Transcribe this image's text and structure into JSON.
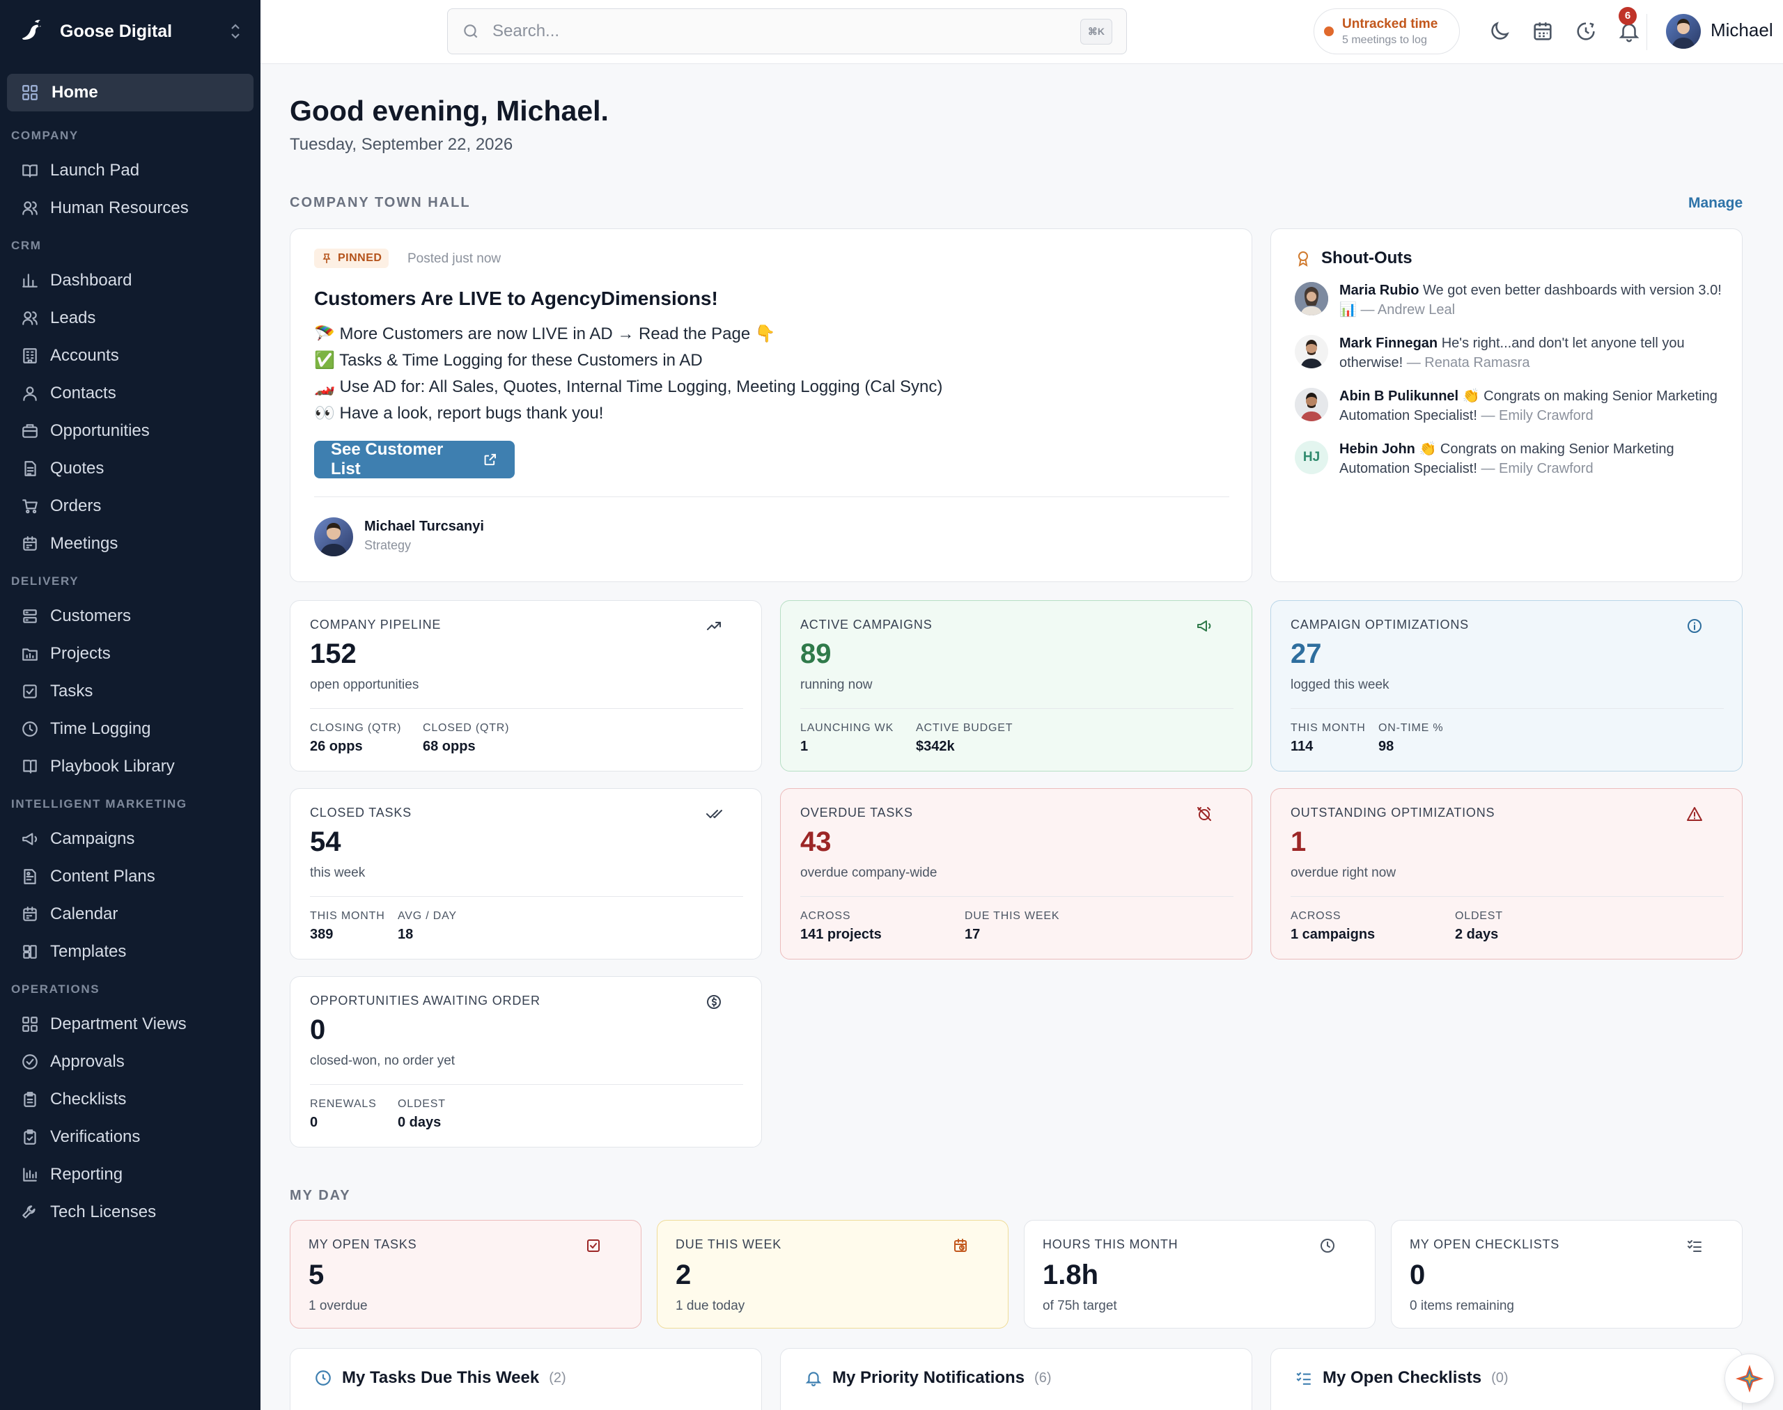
{
  "brand": {
    "name": "Goose Digital"
  },
  "sidebar": {
    "home": "Home",
    "sections": [
      {
        "title": "COMPANY",
        "items": [
          "Launch Pad",
          "Human Resources"
        ]
      },
      {
        "title": "CRM",
        "items": [
          "Dashboard",
          "Leads",
          "Accounts",
          "Contacts",
          "Opportunities",
          "Quotes",
          "Orders",
          "Meetings"
        ]
      },
      {
        "title": "DELIVERY",
        "items": [
          "Customers",
          "Projects",
          "Tasks",
          "Time Logging",
          "Playbook Library"
        ]
      },
      {
        "title": "INTELLIGENT MARKETING",
        "items": [
          "Campaigns",
          "Content Plans",
          "Calendar",
          "Templates"
        ]
      },
      {
        "title": "OPERATIONS",
        "items": [
          "Department Views",
          "Approvals",
          "Checklists",
          "Verifications",
          "Reporting",
          "Tech Licenses"
        ]
      }
    ]
  },
  "topbar": {
    "search_placeholder": "Search...",
    "search_shortcut": "⌘K",
    "untracked_title": "Untracked time",
    "untracked_sub": "5 meetings to log",
    "notification_count": "6",
    "user_name": "Michael"
  },
  "greeting": "Good evening, Michael.",
  "date": "Tuesday, September 22, 2026",
  "town_hall": {
    "section_title": "COMPANY TOWN HALL",
    "manage_label": "Manage",
    "pinned_label": "PINNED",
    "posted": "Posted just now",
    "title": "Customers Are LIVE to AgencyDimensions!",
    "lines": [
      "🪂 More Customers are now LIVE in AD → Read the Page 👇",
      "✅ Tasks & Time Logging for these Customers in AD",
      "🏎️ Use AD for: All Sales, Quotes, Internal Time Logging, Meeting Logging (Cal Sync)",
      "👀 Have a look, report bugs thank you!"
    ],
    "cta_label": "See Customer List",
    "author_name": "Michael Turcsanyi",
    "author_dept": "Strategy"
  },
  "shoutouts": {
    "title": "Shout-Outs",
    "items": [
      {
        "name": "Maria Rubio",
        "message": "We got even better dashboards with version 3.0! 📊",
        "by": "— Andrew Leal"
      },
      {
        "name": "Mark Finnegan",
        "message": "He's right...and don't let anyone tell you otherwise!",
        "by": "— Renata Ramasra"
      },
      {
        "name": "Abin B Pulikunnel",
        "message": "👏 Congrats on making Senior Marketing Automation Specialist!",
        "by": "— Emily Crawford"
      },
      {
        "name": "Hebin John",
        "message": "👏 Congrats on making Senior Marketing Automation Specialist!",
        "by": "— Emily Crawford",
        "initials": "HJ"
      }
    ]
  },
  "stats": [
    {
      "label": "COMPANY PIPELINE",
      "value": "152",
      "sub": "open opportunities",
      "m1_label": "CLOSING (QTR)",
      "m1_value": "26 opps",
      "m2_label": "CLOSED (QTR)",
      "m2_value": "68 opps"
    },
    {
      "label": "ACTIVE CAMPAIGNS",
      "value": "89",
      "sub": "running now",
      "m1_label": "LAUNCHING WK",
      "m1_value": "1",
      "m2_label": "ACTIVE BUDGET",
      "m2_value": "$342k"
    },
    {
      "label": "CAMPAIGN OPTIMIZATIONS",
      "value": "27",
      "sub": "logged this week",
      "m1_label": "THIS MONTH",
      "m1_value": "114",
      "m2_label": "ON-TIME %",
      "m2_value": "98"
    },
    {
      "label": "CLOSED TASKS",
      "value": "54",
      "sub": "this week",
      "m1_label": "THIS MONTH",
      "m1_value": "389",
      "m2_label": "AVG / DAY",
      "m2_value": "18"
    },
    {
      "label": "OVERDUE TASKS",
      "value": "43",
      "sub": "overdue company-wide",
      "m1_label": "ACROSS",
      "m1_value": "141 projects",
      "m2_label": "DUE THIS WEEK",
      "m2_value": "17"
    },
    {
      "label": "OUTSTANDING OPTIMIZATIONS",
      "value": "1",
      "sub": "overdue right now",
      "m1_label": "ACROSS",
      "m1_value": "1 campaigns",
      "m2_label": "OLDEST",
      "m2_value": "2 days"
    },
    {
      "label": "OPPORTUNITIES AWAITING ORDER",
      "value": "0",
      "sub": "closed-won, no order yet",
      "m1_label": "RENEWALS",
      "m1_value": "0",
      "m2_label": "OLDEST",
      "m2_value": "0 days"
    }
  ],
  "my_day": {
    "section_title": "MY DAY",
    "cards": [
      {
        "label": "MY OPEN TASKS",
        "value": "5",
        "sub": "1 overdue"
      },
      {
        "label": "DUE THIS WEEK",
        "value": "2",
        "sub": "1 due today"
      },
      {
        "label": "HOURS THIS MONTH",
        "value": "1.8h",
        "sub": "of 75h target"
      },
      {
        "label": "MY OPEN CHECKLISTS",
        "value": "0",
        "sub": "0 items remaining"
      }
    ]
  },
  "bottom_panels": [
    {
      "title": "My Tasks Due This Week",
      "count": "(2)"
    },
    {
      "title": "My Priority Notifications",
      "count": "(6)"
    },
    {
      "title": "My Open Checklists",
      "count": "(0)"
    }
  ],
  "colors": {
    "sidebar_bg": "#101b2d",
    "accent": "#3e7fb0",
    "badge": "#c03328"
  }
}
